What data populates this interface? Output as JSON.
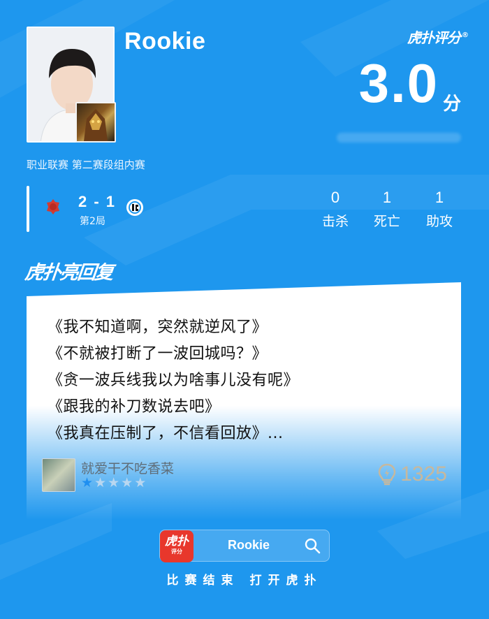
{
  "player": {
    "name": "Rookie",
    "photo_icon": "player-photo",
    "champion_icon": "champion-portrait"
  },
  "brand": {
    "logo_text": "虎扑评分",
    "registered_mark": "®"
  },
  "score": {
    "value": "3.0",
    "unit": "分"
  },
  "match": {
    "league_label": "职业联赛 第二赛段组内赛",
    "series_score": "2 - 1",
    "game_number": "第2局",
    "left_team_icon": "team-badge-red",
    "right_team_icon": "team-badge-ig"
  },
  "stats": [
    {
      "value": "0",
      "label": "击杀"
    },
    {
      "value": "1",
      "label": "死亡"
    },
    {
      "value": "1",
      "label": "助攻"
    }
  ],
  "section": {
    "title": "虎扑亮回复"
  },
  "comment": {
    "quotes": [
      "《我不知道啊，突然就逆风了》",
      "《不就被打断了一波回城吗？》",
      "《贪一波兵线我以为啥事儿没有呢》",
      "《跟我的补刀数说去吧》",
      "《我真在压制了，不信看回放》..."
    ],
    "author": "就爱干不吃香菜",
    "rating": 1,
    "rating_max": 5,
    "likes": "1325",
    "like_icon": "lightbulb-icon"
  },
  "footer": {
    "app_icon_text": "虎扑",
    "app_icon_subtext": "评分",
    "search_text": "Rookie",
    "cta": "比赛结束 打开虎扑"
  },
  "colors": {
    "background": "#1e97ee",
    "star_on": "#1f8ff0",
    "app_red": "#e8372c"
  }
}
